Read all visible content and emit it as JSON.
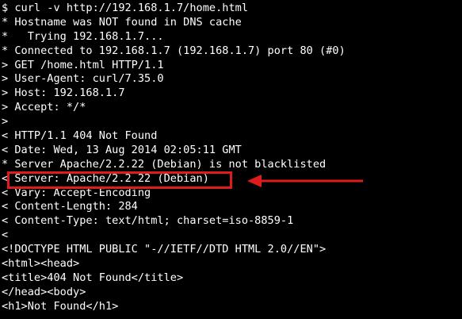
{
  "terminal": {
    "lines": [
      "$ curl -v http://192.168.1.7/home.html",
      "* Hostname was NOT found in DNS cache",
      "*   Trying 192.168.1.7...",
      "* Connected to 192.168.1.7 (192.168.1.7) port 80 (#0)",
      "> GET /home.html HTTP/1.1",
      "> User-Agent: curl/7.35.0",
      "> Host: 192.168.1.7",
      "> Accept: */*",
      ">",
      "< HTTP/1.1 404 Not Found",
      "< Date: Wed, 13 Aug 2014 02:05:11 GMT",
      "* Server Apache/2.2.22 (Debian) is not blacklisted",
      "< Server: Apache/2.2.22 (Debian)",
      "< Vary: Accept-Encoding",
      "< Content-Length: 284",
      "< Content-Type: text/html; charset=iso-8859-1",
      "<",
      "<!DOCTYPE HTML PUBLIC \"-//IETF//DTD HTML 2.0//EN\">",
      "<html><head>",
      "<title>404 Not Found</title>",
      "</head><body>",
      "<h1>Not Found</h1>"
    ]
  },
  "colors": {
    "background": "#000000",
    "text": "#ffffff",
    "annotation": "#e01b1b"
  }
}
